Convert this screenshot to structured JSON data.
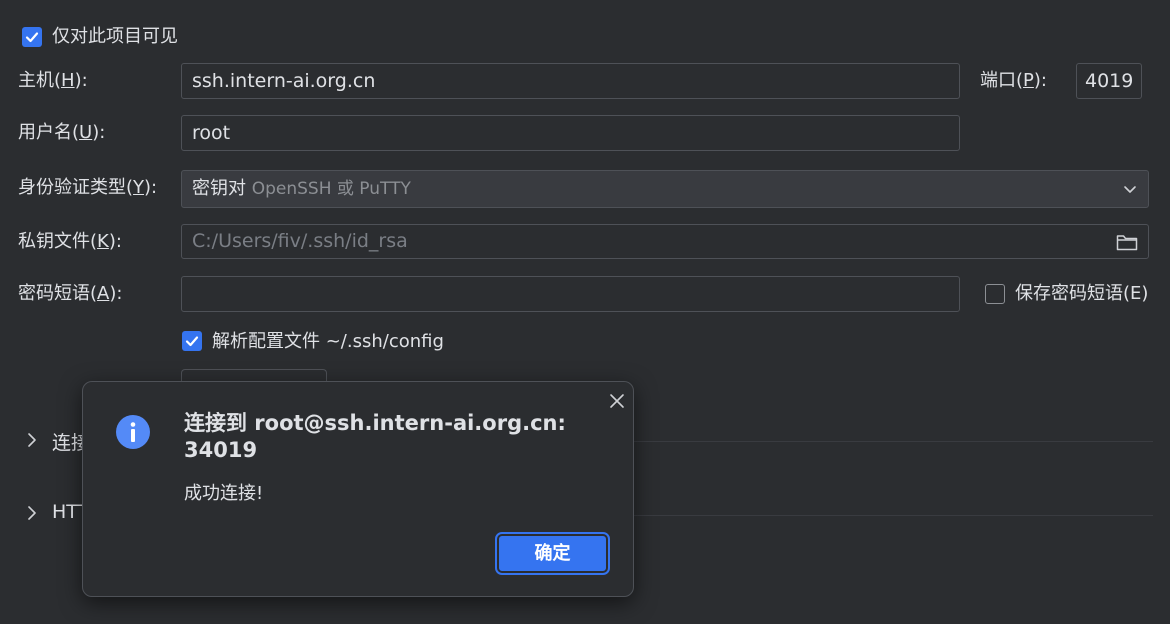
{
  "form": {
    "project_only": {
      "label": "仅对此项目可见",
      "checked": true
    },
    "host": {
      "label_prefix": "主机(",
      "mnemonic": "H",
      "label_suffix": "):",
      "value": "ssh.intern-ai.org.cn"
    },
    "port": {
      "label_prefix": "端口(",
      "mnemonic": "P",
      "label_suffix": "):",
      "value": "4019"
    },
    "username": {
      "label_prefix": "用户名(",
      "mnemonic": "U",
      "label_suffix": "):",
      "value": "root"
    },
    "auth_type": {
      "label_prefix": "身份验证类型(",
      "mnemonic": "Y",
      "label_suffix": "):",
      "selected_main": "密钥对",
      "selected_hint": "OpenSSH 或 PuTTY"
    },
    "private_key": {
      "label_prefix": "私钥文件(",
      "mnemonic": "K",
      "label_suffix": "):",
      "value": "C:/Users/fiv/.ssh/id_rsa"
    },
    "passphrase": {
      "label_prefix": "密码短语(",
      "mnemonic": "A",
      "label_suffix": "):",
      "value": ""
    },
    "save_passphrase": {
      "label": "保存密码短语(E)",
      "checked": false
    },
    "parse_config": {
      "label": "解析配置文件 ~/.ssh/config",
      "checked": true
    }
  },
  "sections": [
    {
      "label": "连接",
      "visible_label": "连接"
    },
    {
      "label": "HTTP",
      "visible_label": "HTT"
    }
  ],
  "dialog": {
    "title": "连接到 root@ssh.intern-ai.org.cn: 34019",
    "message": "成功连接!",
    "ok_label": "确定",
    "icon": "info-icon"
  },
  "colors": {
    "background": "#2b2d30",
    "accent": "#3574f0",
    "info_icon": "#548af7",
    "border": "#4e5157"
  }
}
